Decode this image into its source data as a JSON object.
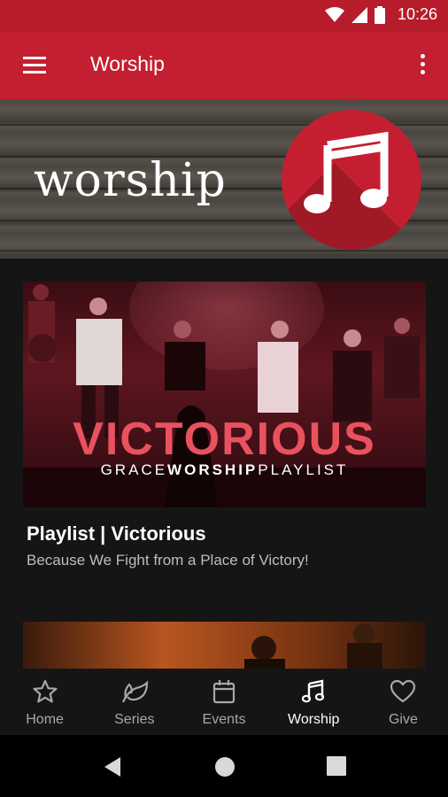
{
  "status_bar": {
    "time": "10:26"
  },
  "app_bar": {
    "title": "Worship"
  },
  "banner": {
    "text": "worship"
  },
  "feed": {
    "items": [
      {
        "title": "Playlist | Victorious",
        "subtitle": "Because We Fight from a Place of Victory!",
        "image_text_main": "VICTORIOUS",
        "image_text_sub_1": "GRACE",
        "image_text_sub_2": "WORSHIP",
        "image_text_sub_3": "PLAYLIST"
      }
    ]
  },
  "bottom_nav": {
    "items": [
      {
        "label": "Home",
        "icon": "star-icon"
      },
      {
        "label": "Series",
        "icon": "leaf-icon"
      },
      {
        "label": "Events",
        "icon": "calendar-icon"
      },
      {
        "label": "Worship",
        "icon": "music-note-icon",
        "active": true
      },
      {
        "label": "Give",
        "icon": "heart-icon"
      }
    ]
  },
  "colors": {
    "primary": "#c41f30",
    "status_bar": "#b71c2b",
    "background": "#151515"
  }
}
